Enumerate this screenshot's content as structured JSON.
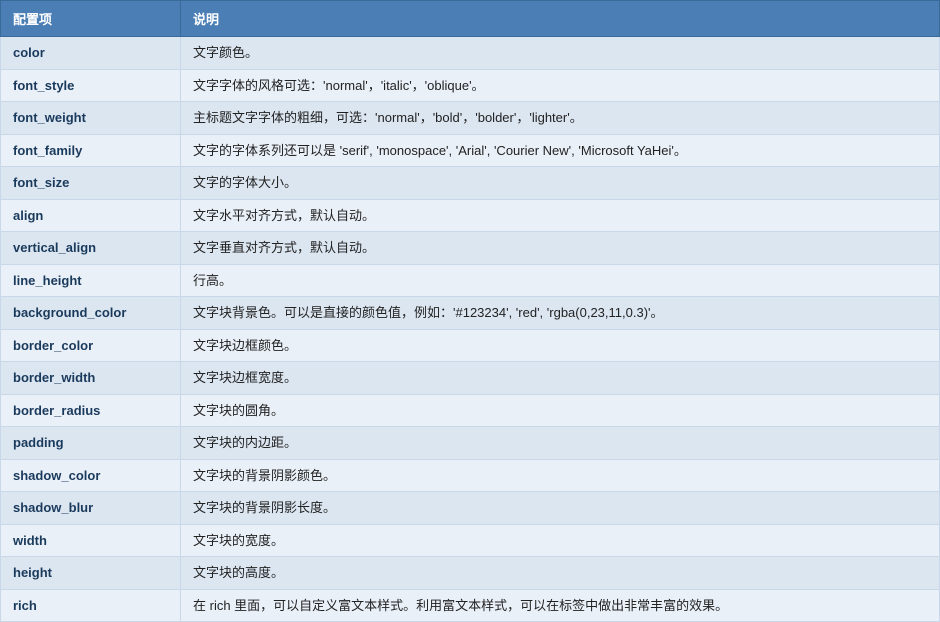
{
  "table": {
    "headers": [
      "配置项",
      "说明"
    ],
    "rows": [
      {
        "key": "color",
        "description": "文字颜色。"
      },
      {
        "key": "font_style",
        "description": "文字字体的风格可选：'normal'，'italic'，'oblique'。"
      },
      {
        "key": "font_weight",
        "description": "主标题文字字体的粗细，可选：'normal'，'bold'，'bolder'，'lighter'。"
      },
      {
        "key": "font_family",
        "description": "文字的字体系列还可以是 'serif', 'monospace', 'Arial', 'Courier New', 'Microsoft YaHei'。"
      },
      {
        "key": "font_size",
        "description": "文字的字体大小。"
      },
      {
        "key": "align",
        "description": "文字水平对齐方式，默认自动。"
      },
      {
        "key": "vertical_align",
        "description": "文字垂直对齐方式，默认自动。"
      },
      {
        "key": "line_height",
        "description": "行高。"
      },
      {
        "key": "background_color",
        "description": "文字块背景色。可以是直接的颜色值，例如：'#123234', 'red', 'rgba(0,23,11,0.3)'。"
      },
      {
        "key": "border_color",
        "description": "文字块边框颜色。"
      },
      {
        "key": "border_width",
        "description": "文字块边框宽度。"
      },
      {
        "key": "border_radius",
        "description": "文字块的圆角。"
      },
      {
        "key": "padding",
        "description": "文字块的内边距。"
      },
      {
        "key": "shadow_color",
        "description": "文字块的背景阴影颜色。"
      },
      {
        "key": "shadow_blur",
        "description": "文字块的背景阴影长度。"
      },
      {
        "key": "width",
        "description": "文字块的宽度。"
      },
      {
        "key": "height",
        "description": "文字块的高度。"
      },
      {
        "key": "rich",
        "description": "在 rich 里面，可以自定义富文本样式。利用富文本样式，可以在标签中做出非常丰富的效果。"
      }
    ]
  }
}
